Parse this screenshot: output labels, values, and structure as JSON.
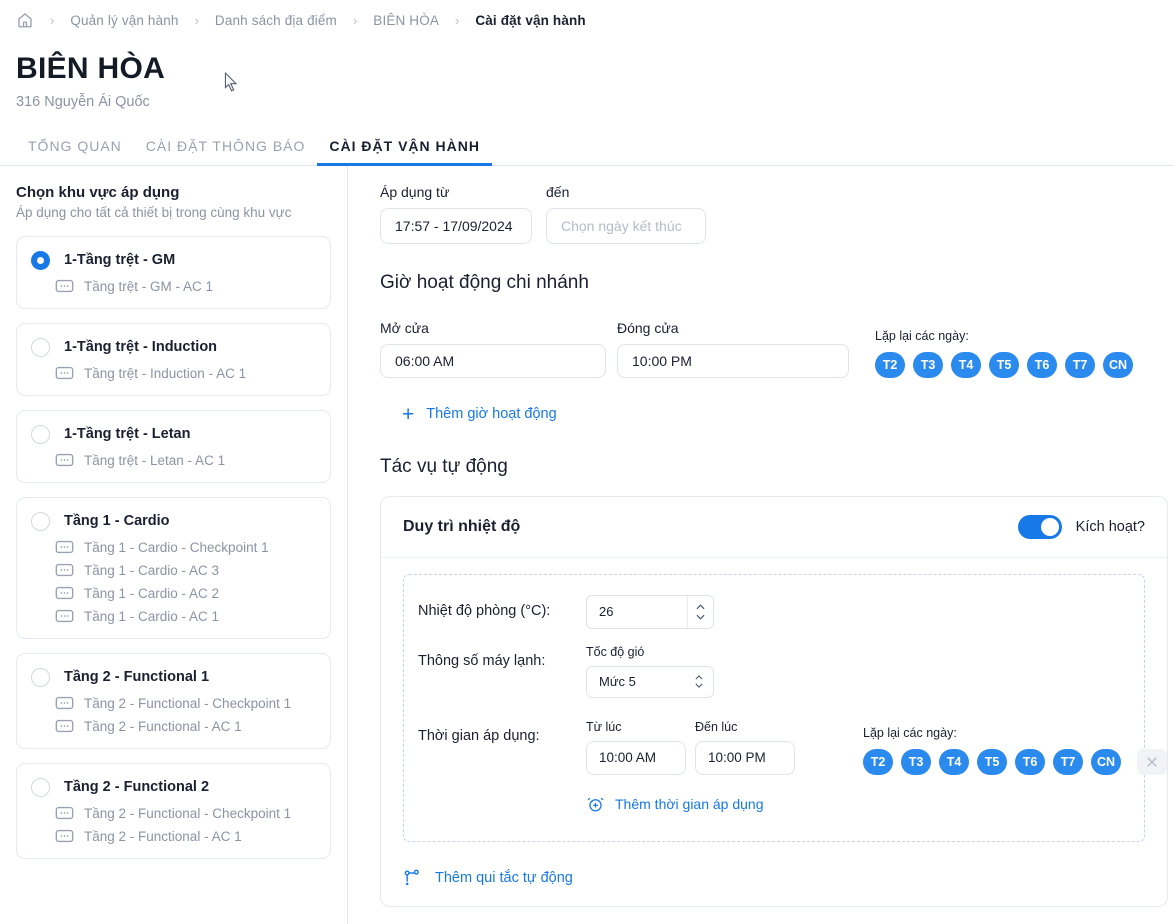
{
  "breadcrumb": {
    "home_icon": "home-icon",
    "separator": "›",
    "items": [
      {
        "label": "Quản lý vận hành",
        "active": false
      },
      {
        "label": "Danh sách địa điểm",
        "active": false
      },
      {
        "label": "BIÊN HÒA",
        "active": false
      },
      {
        "label": "Cài đặt vận hành",
        "active": true
      }
    ]
  },
  "header": {
    "title": "BIÊN HÒA",
    "subtitle": "316 Nguyễn Ái Quốc"
  },
  "tabs": [
    {
      "label": "TỔNG QUAN",
      "active": false
    },
    {
      "label": "CÀI ĐẶT THÔNG BÁO",
      "active": false
    },
    {
      "label": "CÀI ĐẶT VẬN HÀNH",
      "active": true
    }
  ],
  "sidebar": {
    "title": "Chọn khu vực áp dụng",
    "subtitle": "Áp dụng cho tất cả thiết bị trong cùng khu vực",
    "zones": [
      {
        "name": "1-Tầng trệt - GM",
        "selected": true,
        "devices": [
          "Tầng trệt - GM - AC 1"
        ]
      },
      {
        "name": "1-Tầng trệt - Induction",
        "selected": false,
        "devices": [
          "Tầng trệt - Induction - AC 1"
        ]
      },
      {
        "name": "1-Tầng trệt - Letan",
        "selected": false,
        "devices": [
          "Tầng trệt - Letan - AC 1"
        ]
      },
      {
        "name": "Tầng 1 - Cardio",
        "selected": false,
        "devices": [
          "Tầng 1 - Cardio - Checkpoint 1",
          "Tầng 1 - Cardio - AC 3",
          "Tầng 1 - Cardio - AC 2",
          "Tầng 1 - Cardio - AC 1"
        ]
      },
      {
        "name": "Tầng 2 - Functional 1",
        "selected": false,
        "devices": [
          "Tầng 2 - Functional - Checkpoint 1",
          "Tầng 2 - Functional - AC 1"
        ]
      },
      {
        "name": "Tầng 2 - Functional 2",
        "selected": false,
        "devices": [
          "Tầng 2 - Functional - Checkpoint 1",
          "Tầng 2 - Functional - AC 1"
        ]
      }
    ]
  },
  "main": {
    "apply_from_label": "Áp dụng từ",
    "apply_from_value": "17:57 - 17/09/2024",
    "apply_to_label": "đến",
    "apply_to_placeholder": "Chọn ngày kết thúc",
    "operating_hours_title": "Giờ hoạt động chi nhánh",
    "open_label": "Mở cửa",
    "open_value": "06:00 AM",
    "close_label": "Đóng cửa",
    "close_value": "10:00 PM",
    "repeat_days_label": "Lặp lại các ngày:",
    "days": [
      "T2",
      "T3",
      "T4",
      "T5",
      "T6",
      "T7",
      "CN"
    ],
    "add_hours_label": "Thêm giờ hoạt động",
    "add_hours_icon": "plus-icon",
    "auto_tasks_title": "Tác vụ tự động",
    "rule": {
      "title": "Duy trì nhiệt độ",
      "toggle_label": "Kích hoạt?",
      "toggle_on": true,
      "room_temp_label": "Nhiệt độ phòng (°C):",
      "room_temp_value": "26",
      "ac_params_label": "Thông số máy lạnh:",
      "fan_speed_label": "Tốc độ gió",
      "fan_speed_value": "Mức 5",
      "apply_time_label": "Thời gian áp dụng:",
      "from_label": "Từ lúc",
      "from_value": "10:00 AM",
      "to_label": "Đến lúc",
      "to_value": "10:00 PM",
      "repeat_days_label": "Lặp lại các ngày:",
      "days": [
        "T2",
        "T3",
        "T4",
        "T5",
        "T6",
        "T7",
        "CN"
      ],
      "remove_icon": "close-icon",
      "add_time_label": "Thêm thời gian áp dụng",
      "add_time_icon": "alarm-add-icon"
    },
    "add_rule_label": "Thêm qui tắc tự động",
    "add_rule_icon": "rule-add-icon"
  },
  "colors": {
    "accent": "#1778e8",
    "day_chip": "#2b8aee",
    "text": "#1a2030",
    "muted": "#8b94a3"
  }
}
